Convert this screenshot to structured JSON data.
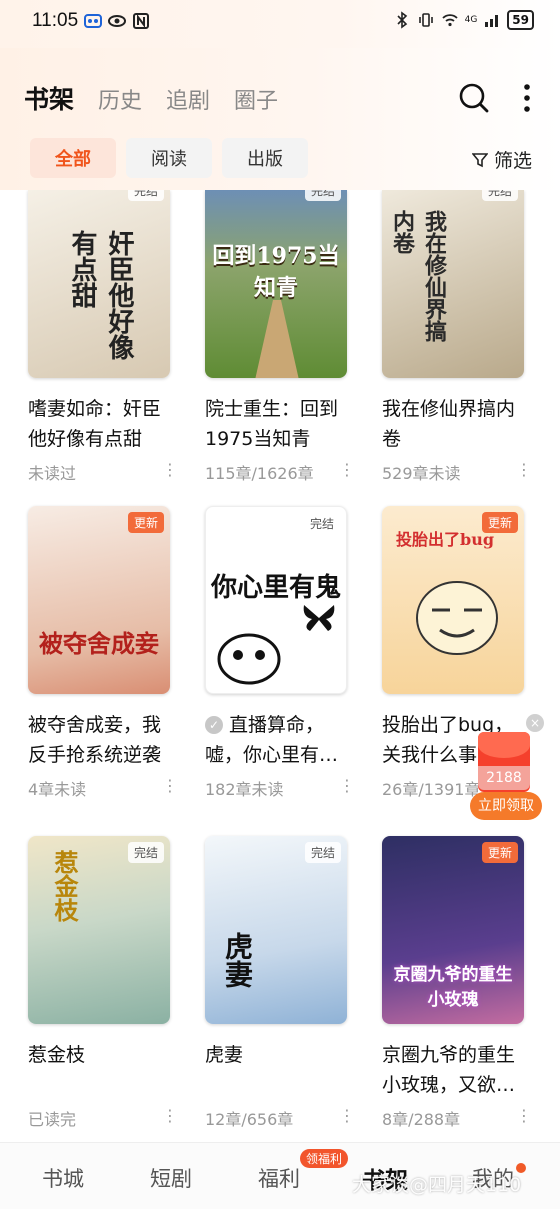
{
  "status_bar": {
    "time": "11:05",
    "signal_text": "4G",
    "battery": "59",
    "icons": [
      "link-icon",
      "eye-icon",
      "nfc-icon",
      "bluetooth-icon",
      "vibrate-icon",
      "wifi-icon",
      "signal-icon"
    ]
  },
  "header": {
    "tabs": [
      {
        "label": "书架",
        "active": true
      },
      {
        "label": "历史",
        "active": false
      },
      {
        "label": "追剧",
        "active": false
      },
      {
        "label": "圈子",
        "active": false
      }
    ],
    "filters": [
      {
        "label": "全部",
        "active": true
      },
      {
        "label": "阅读",
        "active": false
      },
      {
        "label": "出版",
        "active": false
      }
    ],
    "filter_label": "筛选"
  },
  "books": [
    {
      "title": "嗜妻如命：奸臣他好像有点甜",
      "meta": "未读过",
      "badge": "完结",
      "cover_text": "奸臣他好像有点甜",
      "colors": [
        "#f3ede3",
        "#d9cdb9"
      ]
    },
    {
      "title": "院士重生：回到1975当知青",
      "meta": "115章/1626章",
      "badge": "完结",
      "cover_text": "回到1975当知青",
      "colors": [
        "#7fb45a",
        "#4f7a2c"
      ]
    },
    {
      "title": "我在修仙界搞内卷",
      "meta": "529章未读",
      "badge": "完结",
      "cover_text": "我在修仙界搞内卷",
      "colors": [
        "#e9e4d6",
        "#b7a98a"
      ]
    },
    {
      "title": "被夺舍成妾，我反手抢系统逆袭",
      "meta": "4章未读",
      "badge": "更新",
      "cover_text": "被夺舍成妾",
      "colors": [
        "#f6e7dc",
        "#e5b9a3"
      ]
    },
    {
      "title": "直播算命，嘘，你心里有…",
      "meta": "182章未读",
      "badge": "完结",
      "cover_text": "你心里有鬼",
      "colors": [
        "#ffffff",
        "#e8e8e8"
      ],
      "read_check": true
    },
    {
      "title": "投胎出了bug，关我什么事",
      "meta": "26章/1391章",
      "badge": "更新",
      "cover_text": "投胎出了bug",
      "colors": [
        "#fbe2b8",
        "#f5cc86"
      ]
    },
    {
      "title": "惹金枝",
      "meta": "已读完",
      "badge": "完结",
      "cover_text": "惹金枝",
      "colors": [
        "#d8e6df",
        "#a7c2b4"
      ]
    },
    {
      "title": "虎妻",
      "meta": "12章/656章",
      "badge": "完结",
      "cover_text": "虎妻",
      "colors": [
        "#eaf1f7",
        "#b9cde0"
      ]
    },
    {
      "title": "京圈九爷的重生小玫瑰，又欲…",
      "meta": "8章/288章",
      "badge": "更新",
      "cover_text": "京圈九爷的重生小玫瑰",
      "colors": [
        "#3b3a78",
        "#6a4aa0"
      ]
    }
  ],
  "promo": {
    "amount": "2188",
    "button": "立即领取",
    "close": "×"
  },
  "bottom_nav": {
    "items": [
      {
        "label": "书城",
        "active": false
      },
      {
        "label": "短剧",
        "active": false
      },
      {
        "label": "福利",
        "active": false
      },
      {
        "label": "书架",
        "active": true
      },
      {
        "label": "我的",
        "active": false
      }
    ],
    "pill": "领福利"
  },
  "watermark": "大家谈@四月天110"
}
